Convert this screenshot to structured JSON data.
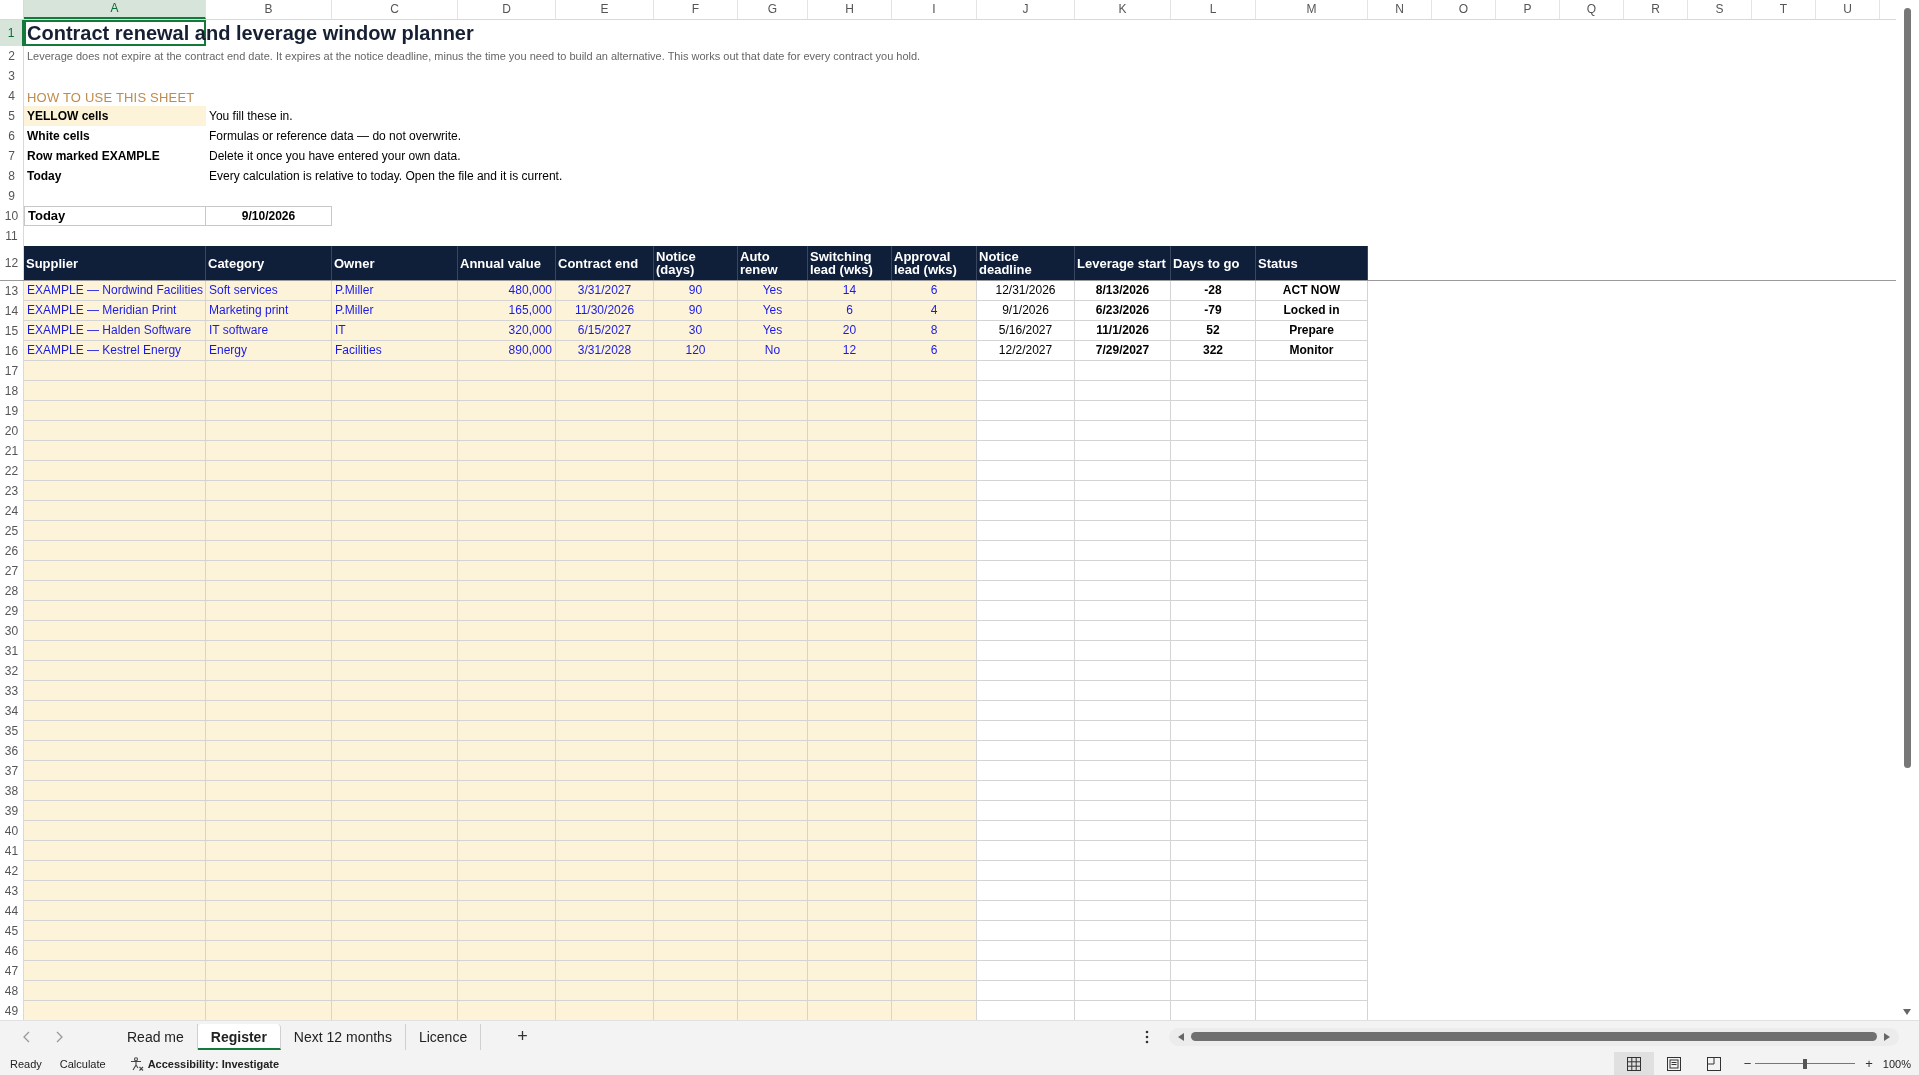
{
  "grid": {
    "column_headers": [
      {
        "label": "A",
        "selected": true
      },
      {
        "label": "B",
        "selected": false
      },
      {
        "label": "C",
        "selected": false
      },
      {
        "label": "D",
        "selected": false
      },
      {
        "label": "E",
        "selected": false
      },
      {
        "label": "F",
        "selected": false
      },
      {
        "label": "G",
        "selected": false
      },
      {
        "label": "H",
        "selected": false
      },
      {
        "label": "I",
        "selected": false
      },
      {
        "label": "J",
        "selected": false
      },
      {
        "label": "K",
        "selected": false
      },
      {
        "label": "L",
        "selected": false
      },
      {
        "label": "M",
        "selected": false
      },
      {
        "label": "N",
        "selected": false
      },
      {
        "label": "O",
        "selected": false
      },
      {
        "label": "P",
        "selected": false
      },
      {
        "label": "Q",
        "selected": false
      },
      {
        "label": "R",
        "selected": false
      },
      {
        "label": "S",
        "selected": false
      },
      {
        "label": "T",
        "selected": false
      },
      {
        "label": "U",
        "selected": false
      }
    ],
    "row_numbers": [
      {
        "label": "1",
        "selected": true
      },
      {
        "label": "2",
        "selected": false
      },
      {
        "label": "3",
        "selected": false
      },
      {
        "label": "4",
        "selected": false
      },
      {
        "label": "5",
        "selected": false
      },
      {
        "label": "6",
        "selected": false
      },
      {
        "label": "7",
        "selected": false
      },
      {
        "label": "8",
        "selected": false
      },
      {
        "label": "9",
        "selected": false
      },
      {
        "label": "10",
        "selected": false
      },
      {
        "label": "11",
        "selected": false
      },
      {
        "label": "12",
        "selected": false
      },
      {
        "label": "13",
        "selected": false
      },
      {
        "label": "14",
        "selected": false
      },
      {
        "label": "15",
        "selected": false
      },
      {
        "label": "16",
        "selected": false
      },
      {
        "label": "17",
        "selected": false
      },
      {
        "label": "18",
        "selected": false
      },
      {
        "label": "19",
        "selected": false
      },
      {
        "label": "20",
        "selected": false
      },
      {
        "label": "21",
        "selected": false
      },
      {
        "label": "22",
        "selected": false
      },
      {
        "label": "23",
        "selected": false
      },
      {
        "label": "24",
        "selected": false
      },
      {
        "label": "25",
        "selected": false
      },
      {
        "label": "26",
        "selected": false
      },
      {
        "label": "27",
        "selected": false
      },
      {
        "label": "28",
        "selected": false
      },
      {
        "label": "29",
        "selected": false
      },
      {
        "label": "30",
        "selected": false
      },
      {
        "label": "31",
        "selected": false
      },
      {
        "label": "32",
        "selected": false
      },
      {
        "label": "33",
        "selected": false
      },
      {
        "label": "34",
        "selected": false
      },
      {
        "label": "35",
        "selected": false
      },
      {
        "label": "36",
        "selected": false
      },
      {
        "label": "37",
        "selected": false
      },
      {
        "label": "38",
        "selected": false
      },
      {
        "label": "39",
        "selected": false
      },
      {
        "label": "40",
        "selected": false
      },
      {
        "label": "41",
        "selected": false
      },
      {
        "label": "42",
        "selected": false
      },
      {
        "label": "43",
        "selected": false
      },
      {
        "label": "44",
        "selected": false
      },
      {
        "label": "45",
        "selected": false
      },
      {
        "label": "46",
        "selected": false
      },
      {
        "label": "47",
        "selected": false
      },
      {
        "label": "48",
        "selected": false
      },
      {
        "label": "49",
        "selected": false
      }
    ]
  },
  "sheet": {
    "title": "Contract renewal and leverage window planner",
    "subtitle": "Leverage does not expire at the contract end date. It expires at the notice deadline, minus the time you need to build an alternative. This works out that date for every contract you hold.",
    "instructions_heading": "HOW TO USE THIS SHEET",
    "instructions": [
      {
        "term": "YELLOW cells",
        "text": "You fill these in.",
        "highlighted": true
      },
      {
        "term": "White cells",
        "text": "Formulas or reference data — do not overwrite.",
        "highlighted": false
      },
      {
        "term": "Row marked EXAMPLE",
        "text": "Delete it once you have entered your own data.",
        "highlighted": false
      },
      {
        "term": "Today",
        "text": "Every calculation is relative to today. Open the file and it is current.",
        "highlighted": false
      }
    ],
    "today": {
      "label": "Today",
      "value": "9/10/2026"
    }
  },
  "table": {
    "columns": [
      {
        "label": "Supplier",
        "kind": "text",
        "input": true,
        "bold": false
      },
      {
        "label": "Category",
        "kind": "text",
        "input": true,
        "bold": false
      },
      {
        "label": "Owner",
        "kind": "text",
        "input": true,
        "bold": false
      },
      {
        "label": "Annual value",
        "kind": "number",
        "input": true,
        "bold": false
      },
      {
        "label": "Contract end",
        "kind": "center",
        "input": true,
        "bold": false
      },
      {
        "label": "Notice (days)",
        "kind": "center",
        "input": true,
        "bold": false
      },
      {
        "label": "Auto renew",
        "kind": "center",
        "input": true,
        "bold": false
      },
      {
        "label": "Switching lead (wks)",
        "kind": "center",
        "input": true,
        "bold": false
      },
      {
        "label": "Approval lead (wks)",
        "kind": "center",
        "input": true,
        "bold": false
      },
      {
        "label": "Notice deadline",
        "kind": "center",
        "input": false,
        "bold": false
      },
      {
        "label": "Leverage start",
        "kind": "center",
        "input": false,
        "bold": true
      },
      {
        "label": "Days to go",
        "kind": "center",
        "input": false,
        "bold": true
      },
      {
        "label": "Status",
        "kind": "center",
        "input": false,
        "bold": true
      }
    ],
    "rows": [
      [
        "EXAMPLE — Nordwind Facilities",
        "Soft services",
        "P.Miller",
        "480,000",
        "3/31/2027",
        "90",
        "Yes",
        "14",
        "6",
        "12/31/2026",
        "8/13/2026",
        "-28",
        "ACT NOW"
      ],
      [
        "EXAMPLE — Meridian Print",
        "Marketing print",
        "P.Miller",
        "165,000",
        "11/30/2026",
        "90",
        "Yes",
        "6",
        "4",
        "9/1/2026",
        "6/23/2026",
        "-79",
        "Locked in"
      ],
      [
        "EXAMPLE — Halden Software",
        "IT software",
        "IT",
        "320,000",
        "6/15/2027",
        "30",
        "Yes",
        "20",
        "8",
        "5/16/2027",
        "11/1/2026",
        "52",
        "Prepare"
      ],
      [
        "EXAMPLE — Kestrel Energy",
        "Energy",
        "Facilities",
        "890,000",
        "3/31/2028",
        "120",
        "No",
        "12",
        "6",
        "12/2/2027",
        "7/29/2027",
        "322",
        "Monitor"
      ]
    ]
  },
  "sheet_tabs": [
    {
      "label": "Read me",
      "selected": false
    },
    {
      "label": "Register",
      "selected": true
    },
    {
      "label": "Next 12 months",
      "selected": false
    },
    {
      "label": "Licence",
      "selected": false
    }
  ],
  "add_sheet_button": "+",
  "status_bar": {
    "items": [
      "Ready",
      "Calculate"
    ],
    "accessibility": "Accessibility: Investigate",
    "views": [
      {
        "kind": "normal",
        "selected": true
      },
      {
        "kind": "page_layout",
        "selected": false
      },
      {
        "kind": "page_break",
        "selected": false
      }
    ],
    "zoom_out": "−",
    "zoom_in": "+",
    "zoom_slider": {
      "level": 0.5
    },
    "zoom": "100%"
  }
}
